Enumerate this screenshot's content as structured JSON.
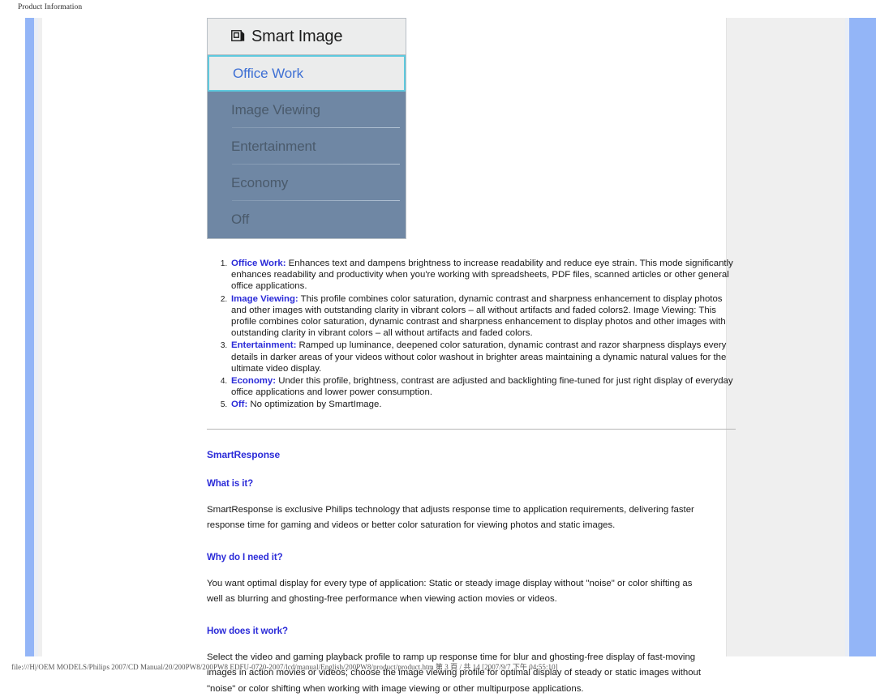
{
  "page": {
    "header_label": "Product Information",
    "status_bar": "file:///H|/OEM MODELS/Philips 2007/CD Manual/20/200PW8/200PW8 EDFU-0720-2007/lcd/manual/English/200PW8/product/product.htm 第 3 頁 / 共 14 [2007/9/7 下午 04:55:10]"
  },
  "smart_image": {
    "title": "Smart Image",
    "title_icon": "smart-image-glyph-icon",
    "selected_option": "Office Work",
    "options": [
      {
        "label": "Image Viewing",
        "rule": true
      },
      {
        "label": "Entertainment",
        "rule": true
      },
      {
        "label": "Economy",
        "rule": true
      },
      {
        "label": "Off",
        "rule": false
      }
    ],
    "accent_selected_border": "#5ec9de",
    "list_background": "#6f87a4"
  },
  "profiles": [
    {
      "term": "Office Work:",
      "text": " Enhances text and dampens brightness to increase readability and reduce eye strain. This mode significantly enhances readability and productivity when you're working with spreadsheets, PDF files, scanned articles or other general office applications."
    },
    {
      "term": "Image Viewing:",
      "text": " This profile combines color saturation, dynamic contrast and sharpness enhancement to display photos and other images with outstanding clarity in vibrant colors – all without artifacts and faded colors2. Image Viewing: This profile combines color saturation, dynamic contrast and sharpness enhancement to display photos and other images with outstanding clarity in vibrant colors – all without artifacts and faded colors."
    },
    {
      "term": "Entertainment:",
      "text": " Ramped up luminance, deepened color saturation, dynamic contrast and razor sharpness displays every details in darker areas of your videos without color washout in brighter areas maintaining a dynamic natural values for the ultimate video display."
    },
    {
      "term": "Economy:",
      "text": " Under this profile, brightness, contrast are adjusted and backlighting fine-tuned for just right display of everyday office applications and lower power consumption."
    },
    {
      "term": "Off:",
      "text": " No optimization by SmartImage."
    }
  ],
  "smart_response": {
    "heading": "SmartResponse",
    "sections": [
      {
        "subheading": "What is it?",
        "body": "SmartResponse is exclusive Philips technology that adjusts response time to application requirements, delivering faster response time for gaming and videos or better color saturation for viewing photos and static images."
      },
      {
        "subheading": "Why do I need it?",
        "body": "You want optimal display for every type of application: Static or steady image display without \"noise\" or color shifting as well as blurring and ghosting-free performance when viewing action movies or videos."
      },
      {
        "subheading": "How does it work?",
        "body": "Select the video and gaming playback profile to ramp up response time for blur and ghosting-free display of fast-moving images in action movies or videos; choose the image viewing profile for optimal display of steady or static images without \"noise\" or color shifting when working with image viewing or other multipurpose applications."
      }
    ]
  },
  "colors": {
    "link_blue": "#2b2bd8",
    "rail_blue": "#93b5f7",
    "selected_text_blue": "#3d6fd4"
  }
}
